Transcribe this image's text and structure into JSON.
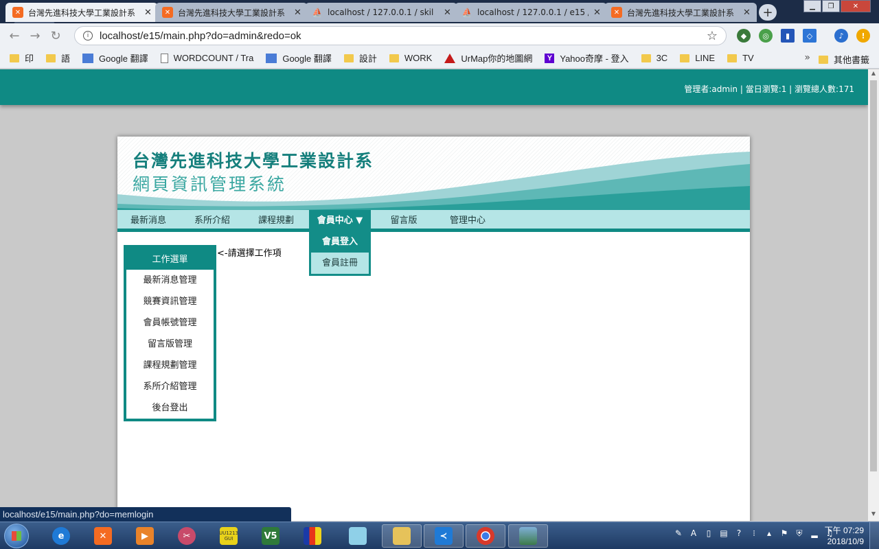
{
  "browser": {
    "tabs": [
      {
        "title": "台灣先進科技大學工業設計系",
        "favicon": "xampp-icon",
        "state": "active"
      },
      {
        "title": "台灣先進科技大學工業設計系",
        "favicon": "xampp-icon",
        "state": "inactive"
      },
      {
        "title": "localhost / 127.0.0.1 / skil",
        "favicon": "phpmyadmin-icon",
        "state": "inactive"
      },
      {
        "title": "localhost / 127.0.0.1 / e15 /",
        "favicon": "phpmyadmin-icon",
        "state": "inactive"
      },
      {
        "title": "台灣先進科技大學工業設計系",
        "favicon": "xampp-icon",
        "state": "inactive"
      }
    ],
    "url": "localhost/e15/main.php?do=admin&redo=ok",
    "bookmarks": [
      "印",
      "語",
      "Google 翻譯",
      "WORDCOUNT / Tra",
      "Google 翻譯",
      "設計",
      "WORK",
      "UrMap你的地圖網",
      "Yahoo奇摩 - 登入",
      "3C",
      "LINE",
      "TV"
    ],
    "other_bookmarks": "其他書籤",
    "status_url": "localhost/e15/main.php?do=memlogin"
  },
  "page": {
    "stats": "管理者:admin | 當日瀏覽:1 | 瀏覽總人數:171",
    "site_title": "台灣先進科技大學工業設計系",
    "site_subtitle": "網頁資訊管理系統",
    "nav": [
      "最新消息",
      "系所介紹",
      "課程規劃",
      "會員中心 ▼",
      "留言版",
      "管理中心"
    ],
    "dropdown": [
      "會員登入",
      "會員註冊"
    ],
    "side_menu_title": "工作選單",
    "side_menu": [
      "最新消息管理",
      "競賽資訊管理",
      "會員帳號管理",
      "留言版管理",
      "課程規劃管理",
      "系所介紹管理",
      "後台登出"
    ],
    "hint": "<-請選擇工作項"
  },
  "taskbar": {
    "clock_time": "下午 07:29",
    "clock_date": "2018/10/9",
    "vs_label": "V5",
    "app_label": "UU1213 GUI"
  },
  "colors": {
    "teal": "#0f8a84",
    "teal_light": "#b5e5e6",
    "chrome_dark": "#1c2c47"
  }
}
